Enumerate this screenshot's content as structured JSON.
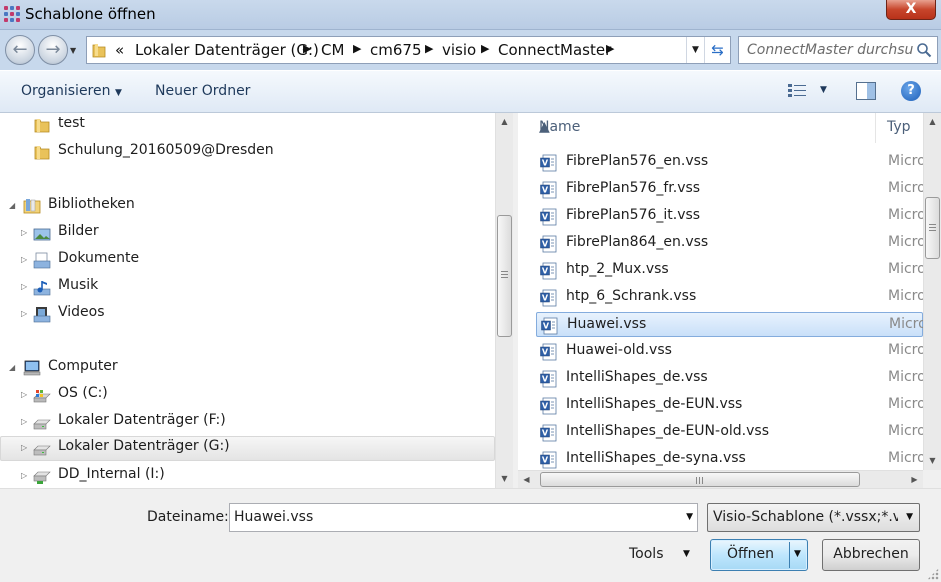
{
  "window": {
    "title": "Schablone öffnen",
    "close_label": "X"
  },
  "address": {
    "overflow_marker": "«",
    "crumbs": [
      "Lokaler Datenträger (G:)",
      "CM",
      "cm675",
      "visio",
      "ConnectMaster"
    ]
  },
  "search": {
    "placeholder": "ConnectMaster durchsu..."
  },
  "toolbar": {
    "organize_label": "Organisieren",
    "new_folder_label": "Neuer Ordner",
    "help_label": "?"
  },
  "nav": {
    "items": [
      {
        "label": "test",
        "icon": "folder-icon",
        "expander": ""
      },
      {
        "label": "Schulung_20160509@Dresden",
        "icon": "folder-icon",
        "expander": ""
      },
      {
        "label": "Bibliotheken",
        "icon": "libraries-icon",
        "expander": "◢"
      },
      {
        "label": "Bilder",
        "icon": "pictures-icon",
        "expander": "▷"
      },
      {
        "label": "Dokumente",
        "icon": "documents-icon",
        "expander": "▷"
      },
      {
        "label": "Musik",
        "icon": "music-icon",
        "expander": "▷"
      },
      {
        "label": "Videos",
        "icon": "videos-icon",
        "expander": "▷"
      },
      {
        "label": "Computer",
        "icon": "computer-icon",
        "expander": "◢"
      },
      {
        "label": "OS (C:)",
        "icon": "os-drive-icon",
        "expander": "▷"
      },
      {
        "label": "Lokaler Datenträger (F:)",
        "icon": "drive-icon",
        "expander": "▷"
      },
      {
        "label": "Lokaler Datenträger (G:)",
        "icon": "drive-icon",
        "expander": "▷",
        "selected": true
      },
      {
        "label": "DD_Internal (I:)",
        "icon": "network-drive-icon",
        "expander": "▷"
      }
    ]
  },
  "files": {
    "columns": {
      "name": "Name",
      "type": "Typ"
    },
    "rows": [
      {
        "name": "FibrePlan576_en.vss",
        "type": "Micro"
      },
      {
        "name": "FibrePlan576_fr.vss",
        "type": "Micro"
      },
      {
        "name": "FibrePlan576_it.vss",
        "type": "Micro"
      },
      {
        "name": "FibrePlan864_en.vss",
        "type": "Micro"
      },
      {
        "name": "htp_2_Mux.vss",
        "type": "Micro"
      },
      {
        "name": "htp_6_Schrank.vss",
        "type": "Micro"
      },
      {
        "name": "Huawei.vss",
        "type": "Micro",
        "selected": true
      },
      {
        "name": "Huawei-old.vss",
        "type": "Micro"
      },
      {
        "name": "IntelliShapes_de.vss",
        "type": "Micro"
      },
      {
        "name": "IntelliShapes_de-EUN.vss",
        "type": "Micro"
      },
      {
        "name": "IntelliShapes_de-EUN-old.vss",
        "type": "Micro"
      },
      {
        "name": "IntelliShapes_de-syna.vss",
        "type": "Micro"
      }
    ]
  },
  "bottom": {
    "filename_label": "Dateiname:",
    "filename_value": "Huawei.vss",
    "filter_value": "Visio-Schablone (*.vssx;*.vssm",
    "tools_label": "Tools",
    "open_label": "Öffnen",
    "cancel_label": "Abbrechen"
  },
  "colors": {
    "accent": "#1e395b",
    "selection": "#cce4f9",
    "close": "#c7452b"
  }
}
